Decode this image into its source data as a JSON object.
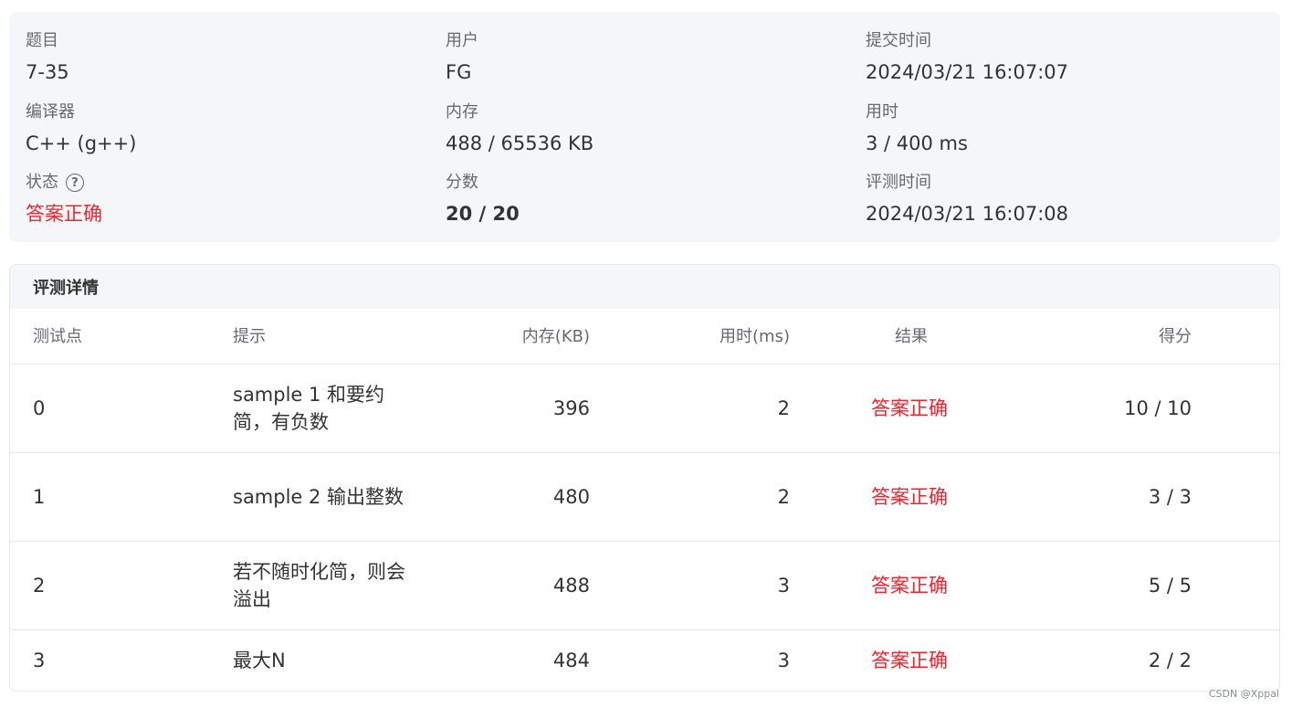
{
  "summary": {
    "problem_label": "题目",
    "problem_value": "7-35",
    "user_label": "用户",
    "user_value": "FG",
    "submit_time_label": "提交时间",
    "submit_time_value": "2024/03/21 16:07:07",
    "compiler_label": "编译器",
    "compiler_value": "C++ (g++)",
    "memory_label": "内存",
    "memory_value": "488 / 65536 KB",
    "time_label": "用时",
    "time_value": "3 / 400 ms",
    "status_label": "状态",
    "status_value": "答案正确",
    "status_color": "#f5222d",
    "score_label": "分数",
    "score_value": "20 / 20",
    "judge_time_label": "评测时间",
    "judge_time_value": "2024/03/21 16:07:08"
  },
  "details": {
    "title": "评测详情",
    "columns": {
      "id": "测试点",
      "hint": "提示",
      "memory": "内存(KB)",
      "time": "用时(ms)",
      "result": "结果",
      "score": "得分"
    },
    "rows": [
      {
        "id": "0",
        "hint": "sample 1 和要约简，有负数",
        "memory": "396",
        "time": "2",
        "result": "答案正确",
        "score": "10 / 10"
      },
      {
        "id": "1",
        "hint": "sample 2 输出整数",
        "memory": "480",
        "time": "2",
        "result": "答案正确",
        "score": "3 / 3"
      },
      {
        "id": "2",
        "hint": "若不随时化简，则会溢出",
        "memory": "488",
        "time": "3",
        "result": "答案正确",
        "score": "5 / 5"
      },
      {
        "id": "3",
        "hint": "最大N",
        "memory": "484",
        "time": "3",
        "result": "答案正确",
        "score": "2 / 2"
      }
    ]
  },
  "watermark": "CSDN @Xppal",
  "icons": {
    "status_help": "question-circle-icon"
  }
}
